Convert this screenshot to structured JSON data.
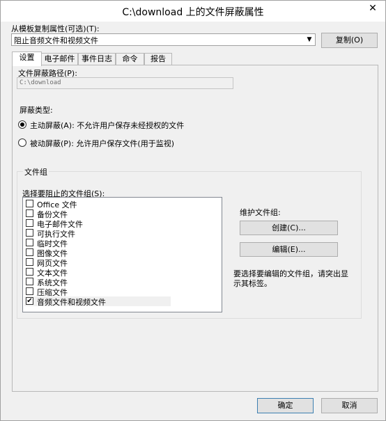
{
  "window": {
    "title": "C:\\download 上的文件屏蔽属性",
    "close_glyph": "✕"
  },
  "template": {
    "label": "从模板复制属性(可选)(T):",
    "selected": "阻止音频文件和视频文件",
    "copy_label": "复制(O)"
  },
  "tabs": [
    {
      "label": "设置"
    },
    {
      "label": "电子邮件"
    },
    {
      "label": "事件日志"
    },
    {
      "label": "命令"
    },
    {
      "label": "报告"
    }
  ],
  "settings": {
    "path_label": "文件屏蔽路径(P):",
    "path_value": "C:\\download",
    "screen_type_label": "屏蔽类型:",
    "active_label": "主动屏蔽(A): 不允许用户保存未经授权的文件",
    "passive_label": "被动屏蔽(P): 允许用户保存文件(用于监视)"
  },
  "file_groups": {
    "group_label": "文件组",
    "select_label": "选择要阻止的文件组(S):",
    "items": [
      {
        "label": "Office 文件",
        "check": ""
      },
      {
        "label": "备份文件",
        "check": ""
      },
      {
        "label": "电子邮件文件",
        "check": ""
      },
      {
        "label": "可执行文件",
        "check": ""
      },
      {
        "label": "临时文件",
        "check": ""
      },
      {
        "label": "图像文件",
        "check": ""
      },
      {
        "label": "网页文件",
        "check": ""
      },
      {
        "label": "文本文件",
        "check": ""
      },
      {
        "label": "系统文件",
        "check": ""
      },
      {
        "label": "压缩文件",
        "check": ""
      },
      {
        "label": "音频文件和视频文件",
        "check": "✔"
      }
    ],
    "maintain_label": "维护文件组:",
    "create_label": "创建(C)...",
    "edit_label": "编辑(E)...",
    "hint": "要选择要编辑的文件组，请突出显示其标签。"
  },
  "footer": {
    "ok_label": "确定",
    "cancel_label": "取消"
  }
}
